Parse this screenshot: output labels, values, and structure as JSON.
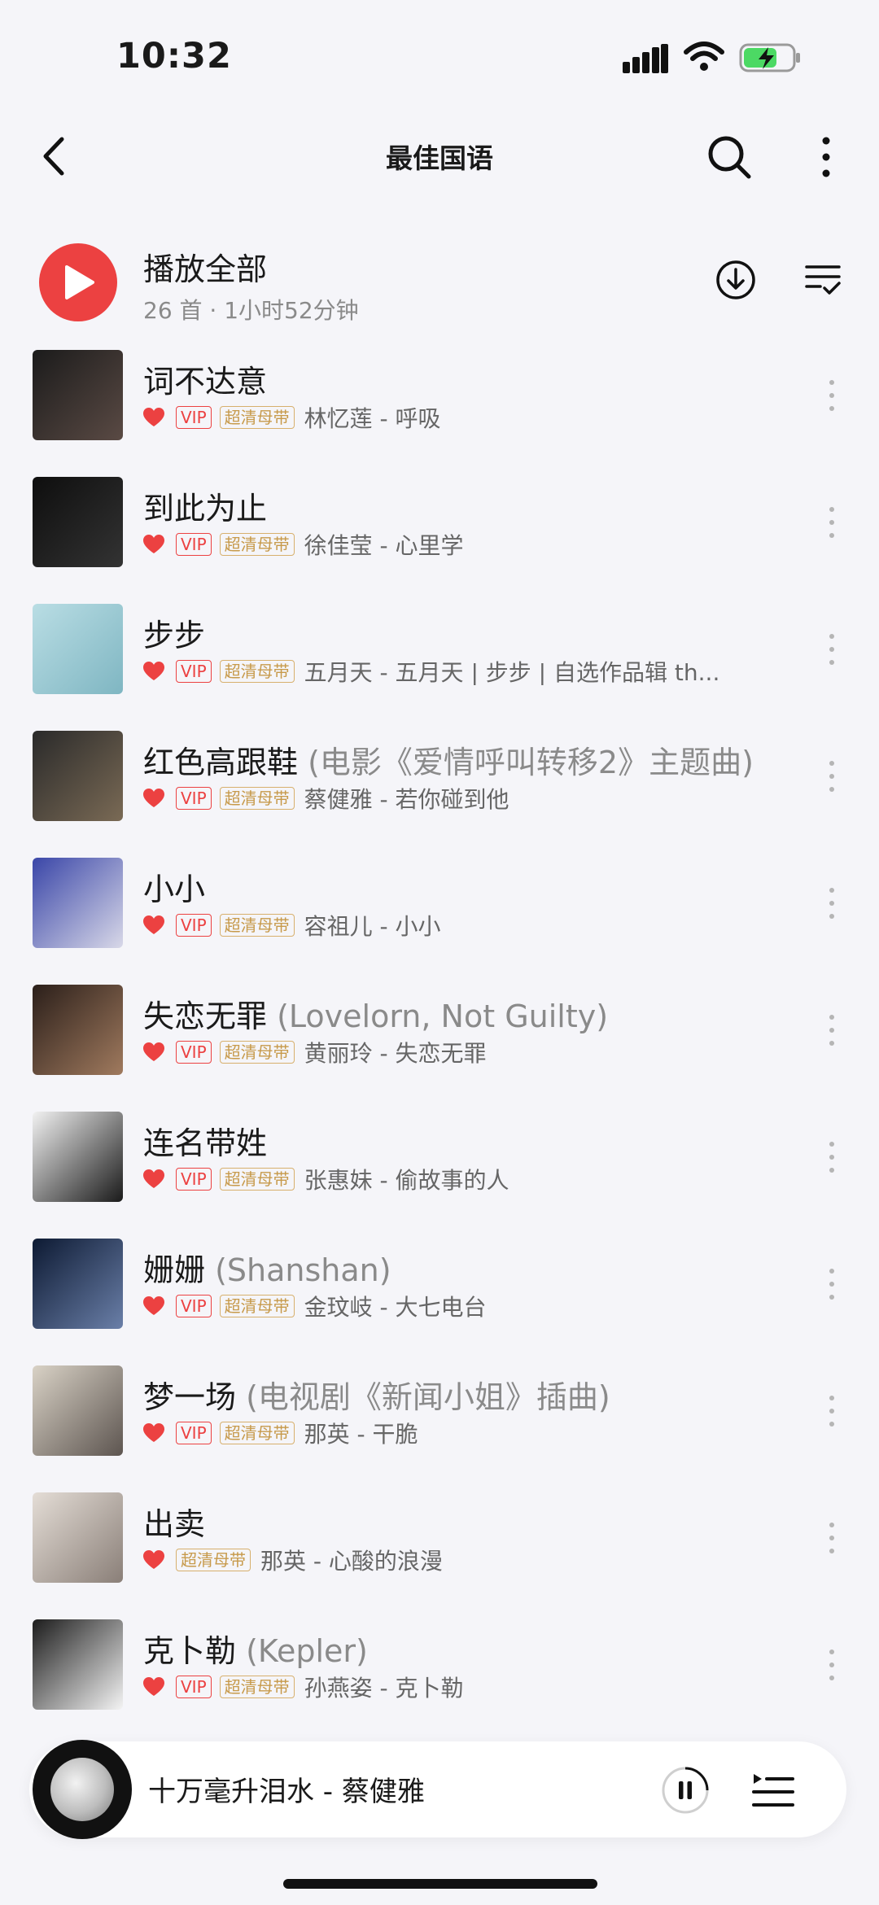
{
  "status_bar": {
    "time": "10:32"
  },
  "header": {
    "title": "最佳国语"
  },
  "play_all": {
    "label": "播放全部",
    "summary": "26 首 · 1小时52分钟"
  },
  "tags": {
    "vip": "VIP",
    "hq": "超清母带"
  },
  "colors": {
    "accent": "#ec4141",
    "hq_gold": "#c79a4b",
    "background": "#f5f5f9"
  },
  "songs": [
    {
      "title": "词不达意",
      "subtitle": "",
      "vip": true,
      "artist_album": "林忆莲 - 呼吸",
      "cover": [
        "#1b1b1b",
        "#5a4a44"
      ]
    },
    {
      "title": "到此为止",
      "subtitle": "",
      "vip": true,
      "artist_album": "徐佳莹 - 心里学",
      "cover": [
        "#0e0e0e",
        "#333"
      ]
    },
    {
      "title": "步步",
      "subtitle": "",
      "vip": true,
      "artist_album": "五月天 - 五月天 | 步步 | 自选作品辑 th...",
      "cover": [
        "#b9dde4",
        "#7fb6c2"
      ]
    },
    {
      "title": "红色高跟鞋",
      "subtitle": " (电影《爱情呼叫转移2》主题曲)",
      "vip": true,
      "artist_album": "蔡健雅 - 若你碰到他",
      "cover": [
        "#2a2a2a",
        "#7a6a55"
      ]
    },
    {
      "title": "小小",
      "subtitle": "",
      "vip": true,
      "artist_album": "容祖儿 - 小小",
      "cover": [
        "#3a46a8",
        "#d8d8e8"
      ]
    },
    {
      "title": "失恋无罪",
      "subtitle": " (Lovelorn, Not Guilty)",
      "vip": true,
      "artist_album": "黄丽玲 - 失恋无罪",
      "cover": [
        "#2b1f1a",
        "#a07a5e"
      ]
    },
    {
      "title": "连名带姓",
      "subtitle": "",
      "vip": true,
      "artist_album": "张惠妹 - 偷故事的人",
      "cover": [
        "#f2f2f2",
        "#1a1a1a"
      ]
    },
    {
      "title": "姗姗",
      "subtitle": " (Shanshan)",
      "vip": true,
      "artist_album": "金玟岐 - 大七电台",
      "cover": [
        "#0d1a33",
        "#6a7fa8"
      ]
    },
    {
      "title": "梦一场",
      "subtitle": " (电视剧《新闻小姐》插曲)",
      "vip": true,
      "artist_album": "那英 - 干脆",
      "cover": [
        "#d9d2c6",
        "#5d5550"
      ]
    },
    {
      "title": "出卖",
      "subtitle": "",
      "vip": false,
      "artist_album": "那英 - 心酸的浪漫",
      "cover": [
        "#e4ddd6",
        "#8a7f78"
      ]
    },
    {
      "title": "克卜勒",
      "subtitle": " (Kepler)",
      "vip": true,
      "artist_album": "孙燕姿 - 克卜勒",
      "cover": [
        "#1c1c1c",
        "#f4f4f4"
      ]
    }
  ],
  "mini_player": {
    "song": "十万毫升泪水",
    "separator": " - ",
    "artist": "蔡健雅"
  }
}
